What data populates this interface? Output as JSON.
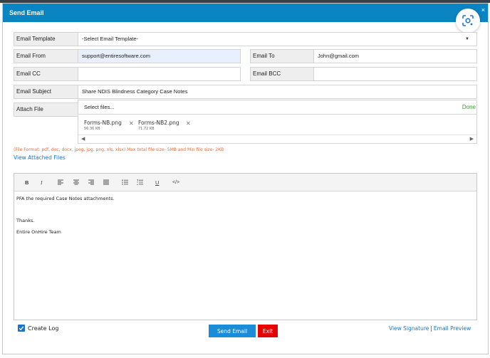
{
  "dialog": {
    "title": "Send Email",
    "close": "×"
  },
  "form": {
    "template": {
      "label": "Email Template",
      "value": "-Select Email Template-"
    },
    "from": {
      "label": "Email From",
      "value": "support@entiresoftware.com"
    },
    "to": {
      "label": "Email To",
      "value": "John@gmail.com"
    },
    "cc": {
      "label": "Email CC",
      "value": ""
    },
    "bcc": {
      "label": "Email BCC",
      "value": ""
    },
    "subject": {
      "label": "Email Subject",
      "value": "Share NDIS Blindness Category Case Notes"
    },
    "attach": {
      "label": "Attach File",
      "select_label": "Select files...",
      "done_label": "Done",
      "files": [
        {
          "name": "Forms-NB.png",
          "size": "56.36 KB"
        },
        {
          "name": "Forms-NB2.png",
          "size": "71.72 KB"
        }
      ]
    }
  },
  "file_info": "(File Format: pdf, doc, docx, jpeg, jpg, png, xls, xlsx) Max total file size- 5MB and Min file size- 2KB",
  "view_attached_files": "View Attached Files",
  "editor": {
    "toolbar": {
      "bold": "B",
      "italic": "I",
      "underline": "U",
      "code": "</>"
    },
    "lines": [
      "PFA the required Case Notes attachments.",
      "",
      "Thanks.",
      "Entire OnHire Team"
    ]
  },
  "footer": {
    "create_log": "Create Log",
    "send_button": "Send Email",
    "exit_button": "Exit",
    "view_signature": "View Signature",
    "separator": "|",
    "email_preview": "Email Preview"
  },
  "colors": {
    "titlebar": "#0b84c4",
    "send_button": "#1b8cd8",
    "exit_button": "#e40404",
    "done": "#3c9d2f",
    "file_info": "#e86d3a",
    "link": "#1a74c8"
  }
}
